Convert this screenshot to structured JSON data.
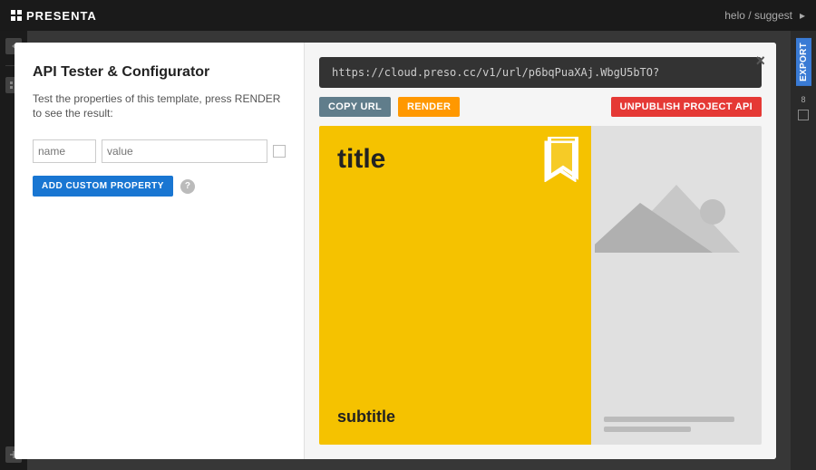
{
  "app": {
    "name": "PRESENTA",
    "user": "helo / suggest"
  },
  "topbar": {
    "logo_text": "PRESENTA",
    "user_label": "helo / suggest",
    "arrow_label": "▸"
  },
  "modal": {
    "title": "API Tester & Configurator",
    "description": "Test the properties of this template, press RENDER to see the result:",
    "close_label": "×",
    "property_name_placeholder": "name",
    "property_value_placeholder": "value",
    "add_custom_label": "ADD CUSTOM PROPERTY",
    "help_icon_label": "?",
    "url": "https://cloud.preso.cc/v1/url/p6bqPuaXAj.WbgU5bTO?",
    "copy_url_label": "COPY URL",
    "render_label": "RENDER",
    "unpublish_label": "UNPUBLISH PROJECT API",
    "preview": {
      "title": "title",
      "subtitle": "subtitle"
    }
  },
  "colors": {
    "accent_blue": "#1976d2",
    "accent_orange": "#ff9800",
    "accent_red": "#e53935",
    "accent_yellow": "#f5c200",
    "slate": "#607d8b",
    "topbar_bg": "#1a1a1a",
    "url_bg": "#333333"
  }
}
